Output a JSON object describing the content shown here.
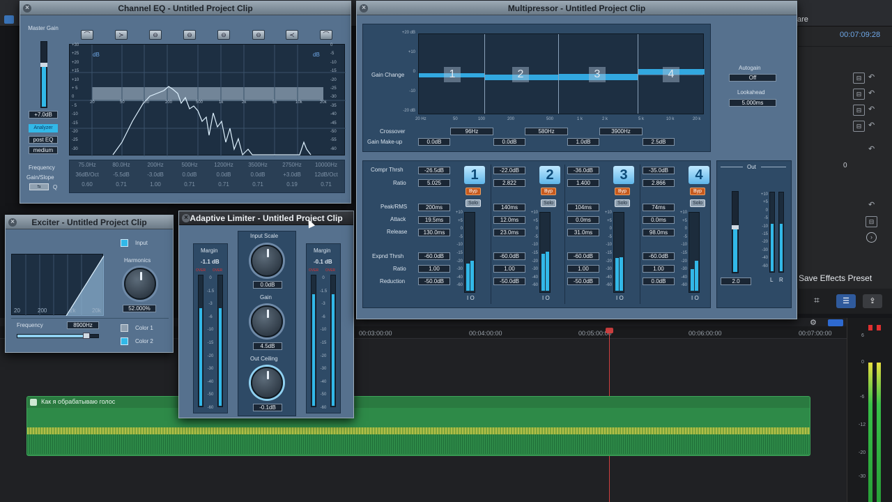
{
  "background": {
    "timecode": "00:07:09:28",
    "share_fragment": "are",
    "save_preset": "Save Effects Preset",
    "side_value": "0",
    "timeline_ticks": [
      "00:03:00:00",
      "00:04:00:00",
      "00:05:00:00",
      "00:06:00:00",
      "00:07:00:00"
    ],
    "clip_name": "Как я обрабатываю голос",
    "meter_scale": [
      "6",
      "0",
      "-6",
      "-12",
      "-20",
      "-30"
    ]
  },
  "channel_eq": {
    "title": "Channel EQ - Untitled Project Clip",
    "master_gain_label": "Master Gain",
    "master_gain_value": "+7.0dB",
    "analyzer": "Analyzer",
    "post_eq": "post EQ",
    "resolution": "medium",
    "db_left": "dB",
    "db_right": "dB",
    "left_scale": [
      "+30",
      "+25",
      "+20",
      "+15",
      "+10",
      "+ 5",
      "0",
      "- 5",
      "-10",
      "-15",
      "-20",
      "-25",
      "-30"
    ],
    "right_scale": [
      "0",
      "-5",
      "-10",
      "-15",
      "-20",
      "-25",
      "-30",
      "-35",
      "-40",
      "-45",
      "-50",
      "-55",
      "-60"
    ],
    "freq_scale": [
      "20",
      "50",
      "100",
      "200",
      "500",
      "1k",
      "2k",
      "5k",
      "10k",
      "20k"
    ],
    "frequency_label": "Frequency",
    "gainslope_label": "Gain/Slope",
    "q_label": "Q",
    "freqs": [
      "75.0Hz",
      "80.0Hz",
      "200Hz",
      "500Hz",
      "1200Hz",
      "3500Hz",
      "2750Hz",
      "10000Hz"
    ],
    "gains": [
      "36dB/Oct",
      "-5.5dB",
      "-3.0dB",
      "0.0dB",
      "0.0dB",
      "0.0dB",
      "+3.0dB",
      "12dB/Oct"
    ],
    "qs": [
      "0.60",
      "0.71",
      "1.00",
      "0.71",
      "0.71",
      "0.71",
      "0.19",
      "0.71"
    ]
  },
  "exciter": {
    "title": "Exciter - Untitled Project Clip",
    "input_label": "Input",
    "harmonics_label": "Harmonics",
    "harmonics_value": "52.000%",
    "frequency_label": "Frequency",
    "frequency_value": "8900Hz",
    "freq_scale": [
      "20",
      "200",
      "2k",
      "20k"
    ],
    "color1": "Color 1",
    "color2": "Color 2"
  },
  "limiter": {
    "title": "Adaptive Limiter - Untitled Project Clip",
    "margin_label": "Margin",
    "margin_left": "-1.1 dB",
    "margin_right": "-0.1 dB",
    "over": "OVER",
    "scale": [
      "0",
      "-1.5",
      "-3",
      "-6",
      "-10",
      "-15",
      "-20",
      "-30",
      "-40",
      "-50",
      "-60"
    ],
    "input_scale_label": "Input Scale",
    "input_scale_value": "0.0dB",
    "gain_label": "Gain",
    "gain_value": "4.5dB",
    "out_ceiling_label": "Out Ceiling",
    "out_ceiling_value": "-0.1dB"
  },
  "multipressor": {
    "title": "Multipressor - Untitled Project Clip",
    "gain_change_label": "Gain Change",
    "gain_scale": [
      "+20 dB",
      "+10",
      "0",
      "-10",
      "-20 dB"
    ],
    "freq_scale": [
      "20 Hz",
      "50",
      "100",
      "200",
      "500",
      "1 k",
      "2 k",
      "5 k",
      "10 k",
      "20 k"
    ],
    "crossover_label": "Crossover",
    "crossovers": [
      "96Hz",
      "580Hz",
      "3900Hz"
    ],
    "makeup_label": "Gain Make-up",
    "makeups": [
      "0.0dB",
      "0.0dB",
      "1.0dB",
      "2.5dB"
    ],
    "autogain_label": "Autogain",
    "autogain_value": "Off",
    "lookahead_label": "Lookahead",
    "lookahead_value": "5.000ms",
    "row_labels": {
      "compr": "Compr Thrsh",
      "ratio": "Ratio",
      "peak": "Peak/RMS",
      "attack": "Attack",
      "release": "Release",
      "expnd": "Expnd Thrsh",
      "ratio2": "Ratio",
      "reduction": "Reduction"
    },
    "byp": "Byp",
    "solo": "Solo",
    "io": "I O",
    "meter_scale": [
      "+10",
      "+5",
      "0",
      "-5",
      "-10",
      "-15",
      "-20",
      "-30",
      "-40",
      "-60"
    ],
    "bands": [
      {
        "num": "1",
        "compr": "-26.5dB",
        "ratio": "5.025",
        "peak": "200ms",
        "attack": "19.5ms",
        "release": "130.0ms",
        "expnd": "-60.0dB",
        "ratio2": "1.00",
        "reduction": "-50.0dB",
        "in_level": 0.35,
        "out_level": 0.38
      },
      {
        "num": "2",
        "compr": "-22.0dB",
        "ratio": "2.822",
        "peak": "140ms",
        "attack": "12.0ms",
        "release": "23.0ms",
        "expnd": "-60.0dB",
        "ratio2": "1.00",
        "reduction": "-50.0dB",
        "in_level": 0.47,
        "out_level": 0.5
      },
      {
        "num": "3",
        "compr": "-36.0dB",
        "ratio": "1.400",
        "peak": "104ms",
        "attack": "0.0ms",
        "release": "31.0ms",
        "expnd": "-60.0dB",
        "ratio2": "1.00",
        "reduction": "-50.0dB",
        "in_level": 0.42,
        "out_level": 0.43
      },
      {
        "num": "4",
        "compr": "-35.0dB",
        "ratio": "2.866",
        "peak": "74ms",
        "attack": "0.0ms",
        "release": "98.0ms",
        "expnd": "-60.0dB",
        "ratio2": "1.00",
        "reduction": "0.0dB",
        "in_level": 0.28,
        "out_level": 0.38
      }
    ],
    "out_label": "Out",
    "out_value": "2.0",
    "out_scale": [
      "+10",
      "+5",
      "0",
      "-5",
      "-10",
      "-15",
      "-20",
      "-30",
      "-40",
      "-60"
    ],
    "lr": [
      "L",
      "R"
    ]
  }
}
